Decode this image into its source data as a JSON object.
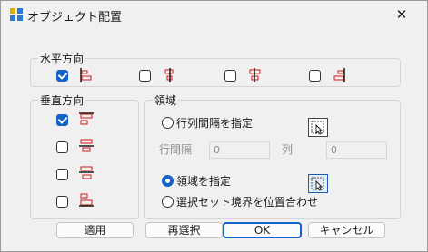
{
  "window": {
    "title": "オブジェクト配置",
    "close_glyph": "✕"
  },
  "horizontal": {
    "legend": "水平方向",
    "options": [
      {
        "checked": true,
        "icon": "align-left-icon"
      },
      {
        "checked": false,
        "icon": "align-center-icon"
      },
      {
        "checked": false,
        "icon": "align-center-line-icon"
      },
      {
        "checked": false,
        "icon": "align-right-icon"
      }
    ]
  },
  "vertical": {
    "legend": "垂直方向",
    "options": [
      {
        "checked": true,
        "icon": "align-top-icon"
      },
      {
        "checked": false,
        "icon": "align-middle-icon"
      },
      {
        "checked": false,
        "icon": "align-middle-line-icon"
      },
      {
        "checked": false,
        "icon": "align-bottom-icon"
      }
    ]
  },
  "region": {
    "legend": "領域",
    "row_col_spacing_label": "行列間隔を指定",
    "row_spacing_label": "行間隔",
    "row_spacing_value": "0",
    "col_label": "列",
    "col_value": "0",
    "specify_region_label": "領域を指定",
    "selection_bounds_label": "選択セット境界を位置合わせ",
    "selected_mode": "specify_region"
  },
  "buttons": {
    "apply": "適用",
    "reselect": "再選択",
    "ok": "OK",
    "cancel": "キャンセル"
  },
  "colors": {
    "accent": "#1464c8",
    "icon_red": "#d01818",
    "icon_blue": "#1a5fb4"
  }
}
